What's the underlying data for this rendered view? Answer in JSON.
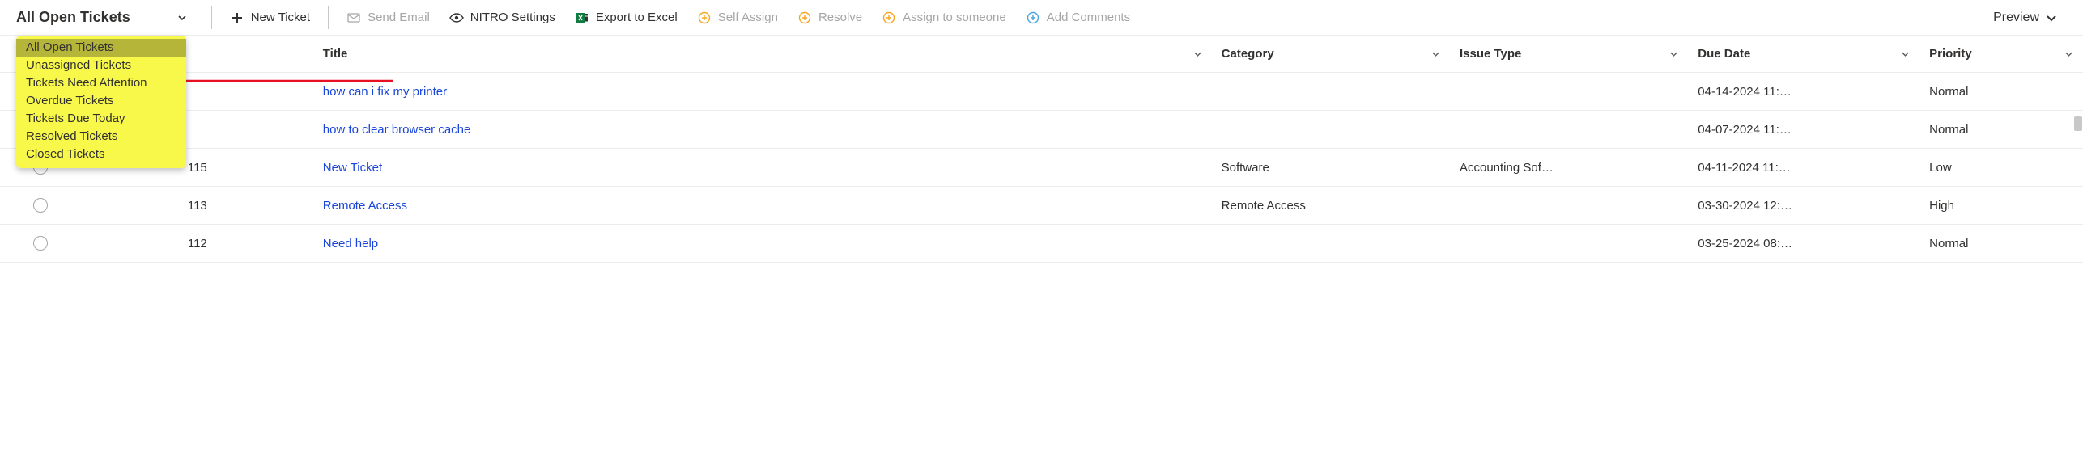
{
  "view_selector": {
    "current": "All Open Tickets",
    "options": [
      "All Open Tickets",
      "Unassigned Tickets",
      "Tickets Need Attention",
      "Overdue Tickets",
      "Tickets Due Today",
      "Resolved Tickets",
      "Closed Tickets"
    ]
  },
  "toolbar": {
    "new_ticket": "New Ticket",
    "send_email": "Send Email",
    "nitro_settings": "NITRO Settings",
    "export_excel": "Export to Excel",
    "self_assign": "Self Assign",
    "resolve": "Resolve",
    "assign_someone": "Assign to someone",
    "add_comments": "Add Comments",
    "preview": "Preview"
  },
  "columns": {
    "title": "Title",
    "category": "Category",
    "issue_type": "Issue Type",
    "due_date": "Due Date",
    "priority": "Priority"
  },
  "rows": [
    {
      "id": "",
      "title": "how can i fix my printer",
      "category": "",
      "issue_type": "",
      "due_date": "04-14-2024 11:…",
      "priority": "Normal"
    },
    {
      "id": "",
      "title": "how to clear browser cache",
      "category": "",
      "issue_type": "",
      "due_date": "04-07-2024 11:…",
      "priority": "Normal"
    },
    {
      "id": "115",
      "title": "New Ticket",
      "category": "Software",
      "issue_type": "Accounting Sof…",
      "due_date": "04-11-2024 11:…",
      "priority": "Low"
    },
    {
      "id": "113",
      "title": "Remote Access",
      "category": "Remote Access",
      "issue_type": "",
      "due_date": "03-30-2024 12:…",
      "priority": "High"
    },
    {
      "id": "112",
      "title": "Need help",
      "category": "",
      "issue_type": "",
      "due_date": "03-25-2024 08:…",
      "priority": "Normal"
    }
  ]
}
